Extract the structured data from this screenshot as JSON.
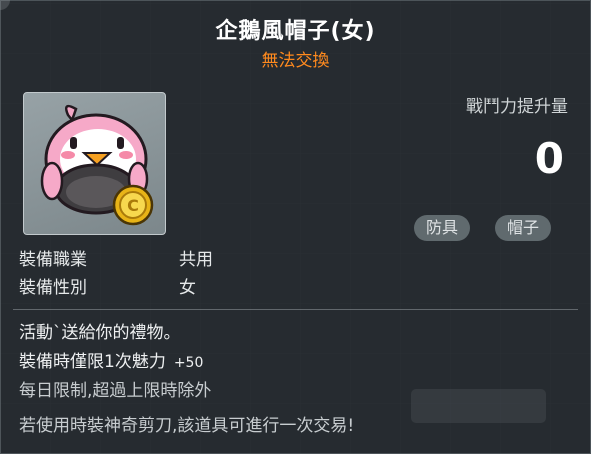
{
  "item": {
    "name": "企鵝風帽子(女)",
    "trade_status": "無法交換"
  },
  "combat_power": {
    "label": "戰鬥力提升量",
    "value": "0"
  },
  "tags": [
    "防具",
    "帽子"
  ],
  "info": {
    "job_label": "裝備職業",
    "job_value": "共用",
    "gender_label": "裝備性別",
    "gender_value": "女"
  },
  "description": {
    "line1": "活動`送給你的禮物。",
    "line2_main": "裝備時僅限1次魅力",
    "line2_bonus": "+50",
    "line3": "每日限制,超過上限時除外",
    "line4": "若使用時裝神奇剪刀,該道具可進行一次交易!"
  },
  "icons": {
    "item": "penguin-hat-icon",
    "coin": "gold-coin-icon"
  },
  "colors": {
    "title": "#ffffff",
    "trade_status": "#ff8a1e",
    "panel_bg": "#20262a"
  }
}
